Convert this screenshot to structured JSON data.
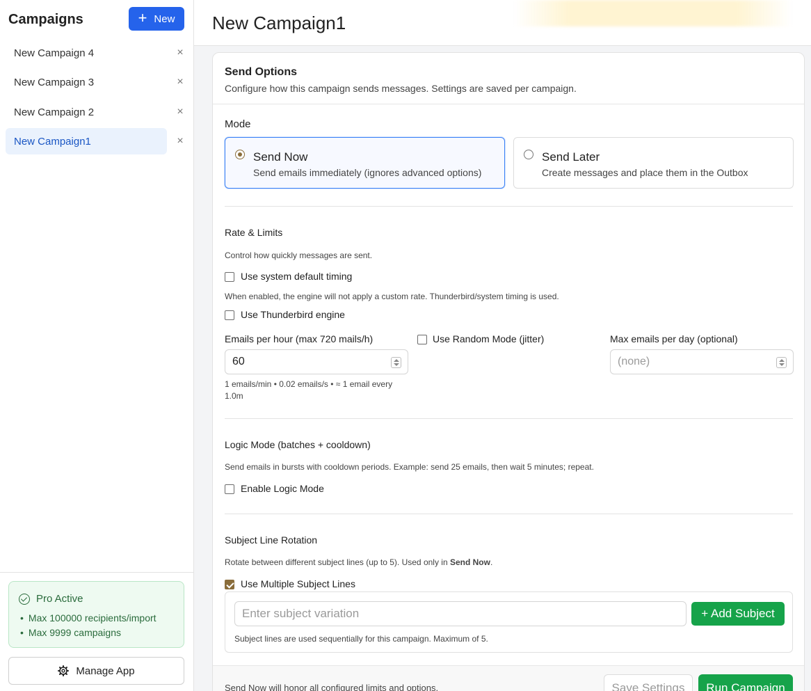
{
  "sidebar": {
    "title": "Campaigns",
    "new_button": {
      "icon": "plus-icon",
      "label": "New"
    },
    "campaigns": [
      {
        "name": "New Campaign 4",
        "active": false
      },
      {
        "name": "New Campaign 3",
        "active": false
      },
      {
        "name": "New Campaign 2",
        "active": false
      },
      {
        "name": "New Campaign1",
        "active": true
      }
    ],
    "close_glyph": "×",
    "pro": {
      "status": "Pro Active",
      "features": [
        "Max 100000 recipients/import",
        "Max 9999 campaigns"
      ]
    },
    "manage_label": "Manage App"
  },
  "header": {
    "title": "New Campaign1"
  },
  "send_options": {
    "title": "Send Options",
    "subtitle": "Configure how this campaign sends messages. Settings are saved per campaign.",
    "mode_label": "Mode",
    "modes": [
      {
        "title": "Send Now",
        "desc": "Send emails immediately (ignores advanced options)",
        "selected": true
      },
      {
        "title": "Send Later",
        "desc": "Create messages and place them in the Outbox",
        "selected": false
      }
    ]
  },
  "rate_limits": {
    "title": "Rate & Limits",
    "desc": "Control how quickly messages are sent.",
    "system_default_label": "Use system default timing",
    "system_default_checked": false,
    "system_default_note": "When enabled, the engine will not apply a custom rate. Thunderbird/system timing is used.",
    "thunderbird_label": "Use Thunderbird engine",
    "thunderbird_checked": false,
    "emails_per_hour_label": "Emails per hour (max 720 mails/h)",
    "emails_per_hour_value": "60",
    "rate_hint_line1": "1 emails/min • 0.02 emails/s • ≈ 1 email every",
    "rate_hint_line2": "1.0m",
    "random_mode_label": "Use Random Mode (jitter)",
    "random_mode_checked": false,
    "max_per_day_label": "Max emails per day (optional)",
    "max_per_day_placeholder": "(none)"
  },
  "logic_mode": {
    "title": "Logic Mode (batches + cooldown)",
    "desc": "Send emails in bursts with cooldown periods. Example: send 25 emails, then wait 5 minutes; repeat.",
    "enable_label": "Enable Logic Mode",
    "enable_checked": false
  },
  "subject_rotation": {
    "title": "Subject Line Rotation",
    "desc_prefix": "Rotate between different subject lines (up to 5). Used only in ",
    "desc_bold": "Send Now",
    "desc_suffix": ".",
    "multi_label": "Use Multiple Subject Lines",
    "multi_checked": true,
    "input_placeholder": "Enter subject variation",
    "add_label": "+ Add Subject",
    "note": "Subject lines are used sequentially for this campaign. Maximum of 5."
  },
  "footer": {
    "note": "Send Now will honor all configured limits and options.",
    "save_label": "Save Settings",
    "run_label": "Run Campaign"
  },
  "colors": {
    "accent_blue": "#2563eb",
    "success_green": "#16a34a",
    "checkbox_brown": "#8a6d3b"
  }
}
